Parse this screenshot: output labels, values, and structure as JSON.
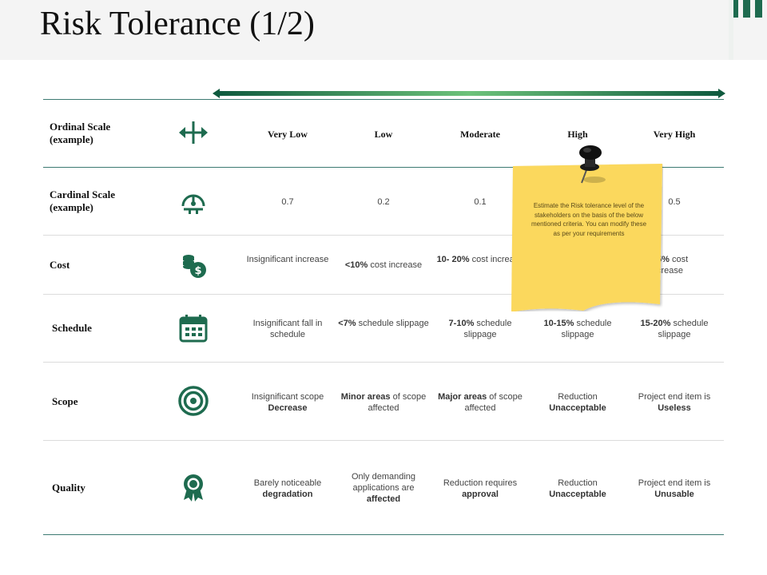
{
  "title": "Risk Tolerance (1/2)",
  "columns": [
    "Very Low",
    "Low",
    "Moderate",
    "High",
    "Very High"
  ],
  "rows": [
    {
      "label": "Ordinal Scale (example)",
      "icon": "horizontal-double-arrow-icon"
    },
    {
      "label": "Cardinal Scale (example)",
      "icon": "gauge-icon",
      "cells": [
        "0.7",
        "0.2",
        "0.1",
        "",
        "0.5"
      ]
    },
    {
      "label": "Cost",
      "icon": "coins-dollar-icon",
      "cells": [
        {
          "pre": "Insignificant increase",
          "bold": "",
          "post": ""
        },
        {
          "pre": "",
          "bold": "<10%",
          "post": " cost increase"
        },
        {
          "pre": "",
          "bold": "10- 20%",
          "post": " cost increase"
        },
        {
          "pre": "",
          "bold": "",
          "post": ""
        },
        {
          "pre": "",
          "bold": "5%",
          "post": " cost crease"
        }
      ]
    },
    {
      "label": "Schedule",
      "icon": "calendar-icon",
      "cells": [
        {
          "pre": "Insignificant fall in schedule",
          "bold": "",
          "post": ""
        },
        {
          "pre": "",
          "bold": "<7%",
          "post": " schedule slippage"
        },
        {
          "pre": "",
          "bold": "7-10%",
          "post": " schedule slippage"
        },
        {
          "pre": "",
          "bold": "10-15%",
          "post": " schedule slippage"
        },
        {
          "pre": "",
          "bold": "15-20%",
          "post": " schedule slippage"
        }
      ]
    },
    {
      "label": "Scope",
      "icon": "target-icon",
      "cells": [
        {
          "pre": "Insignificant scope ",
          "bold": "Decrease",
          "post": ""
        },
        {
          "pre": "",
          "bold": "Minor areas",
          "post": " of scope affected"
        },
        {
          "pre": "",
          "bold": "Major areas",
          "post": " of scope affected"
        },
        {
          "pre": "Reduction ",
          "bold": "Unacceptable",
          "post": ""
        },
        {
          "pre": "Project end item is ",
          "bold": "Useless",
          "post": ""
        }
      ]
    },
    {
      "label": "Quality",
      "icon": "award-badge-icon",
      "cells": [
        {
          "pre": "Barely noticeable ",
          "bold": "degradation",
          "post": ""
        },
        {
          "pre": "Only demanding applications are ",
          "bold": "affected",
          "post": ""
        },
        {
          "pre": "Reduction requires ",
          "bold": "approval",
          "post": ""
        },
        {
          "pre": "Reduction ",
          "bold": "Unacceptable",
          "post": ""
        },
        {
          "pre": "Project end item is ",
          "bold": "Unusable",
          "post": ""
        }
      ]
    }
  ],
  "note": {
    "text": "Estimate the Risk tolerance level of the stakeholders on the basis of the below mentioned criteria. You can modify these as per your requirements",
    "icon": "push-pin-icon"
  },
  "colors": {
    "accent": "#1e6b4f",
    "arrow_dark": "#0f5a3e",
    "arrow_light": "#6dc27a",
    "note_yellow": "#fbd85d",
    "rule_dark": "#3c7a72",
    "rule_light": "#dcdcdc"
  }
}
